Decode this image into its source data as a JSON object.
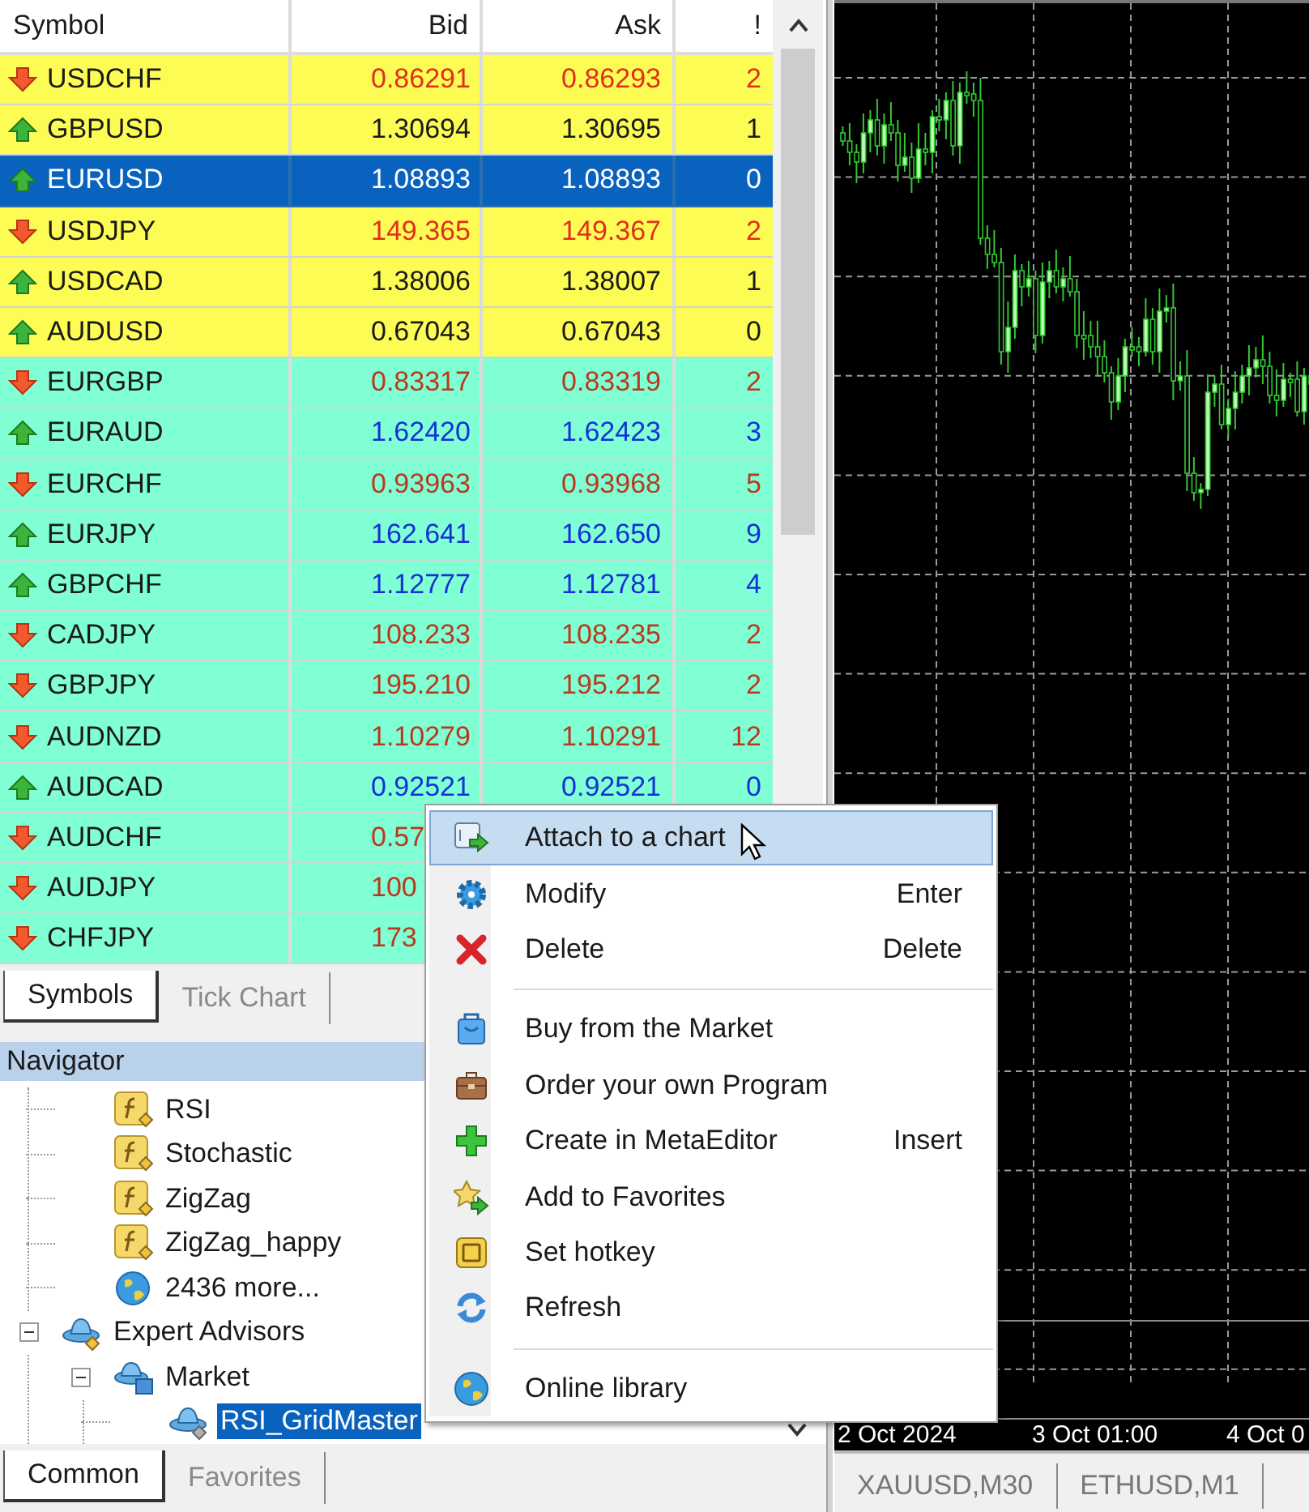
{
  "market_watch": {
    "columns": [
      "Symbol",
      "Bid",
      "Ask",
      "!"
    ],
    "rows": [
      {
        "symbol": "USDCHF",
        "kind": "down",
        "color": "#fcfc55",
        "selected": false,
        "quote": {
          "bid": "0.86291",
          "ask": "0.86293",
          "spread": "2",
          "color": "#e0301c"
        }
      },
      {
        "symbol": "GBPUSD",
        "kind": "up",
        "color": "#fcfc55",
        "selected": false,
        "quote": {
          "bid": "1.30694",
          "ask": "1.30695",
          "spread": "1",
          "color": "#1a1a1a"
        }
      },
      {
        "symbol": "EURUSD",
        "kind": "up",
        "selected": true,
        "quote": {
          "bid": "1.08893",
          "ask": "1.08893",
          "spread": "0"
        }
      },
      {
        "symbol": "USDJPY",
        "kind": "down",
        "color": "#fcfc55",
        "selected": false,
        "quote": {
          "bid": "149.365",
          "ask": "149.367",
          "spread": "2",
          "color": "#e0301c"
        }
      },
      {
        "symbol": "USDCAD",
        "kind": "up",
        "color": "#fcfc55",
        "selected": false,
        "quote": {
          "bid": "1.38006",
          "ask": "1.38007",
          "spread": "1",
          "color": "#1a1a1a"
        }
      },
      {
        "symbol": "AUDUSD",
        "kind": "up",
        "color": "#fcfc55",
        "selected": false,
        "quote": {
          "bid": "0.67043",
          "ask": "0.67043",
          "spread": "0",
          "color": "#1a1a1a"
        }
      },
      {
        "symbol": "EURGBP",
        "kind": "down",
        "color": "#80ffd4",
        "selected": false,
        "quote": {
          "bid": "0.83317",
          "ask": "0.83319",
          "spread": "2",
          "color": "#b8391e"
        }
      },
      {
        "symbol": "EURAUD",
        "kind": "up",
        "color": "#80ffd4",
        "selected": false,
        "quote": {
          "bid": "1.62420",
          "ask": "1.62423",
          "spread": "3",
          "color": "#1430d8"
        }
      },
      {
        "symbol": "EURCHF",
        "kind": "down",
        "color": "#80ffd4",
        "selected": false,
        "quote": {
          "bid": "0.93963",
          "ask": "0.93968",
          "spread": "5",
          "color": "#b8391e"
        }
      },
      {
        "symbol": "EURJPY",
        "kind": "up",
        "color": "#80ffd4",
        "selected": false,
        "quote": {
          "bid": "162.641",
          "ask": "162.650",
          "spread": "9",
          "color": "#1430d8"
        }
      },
      {
        "symbol": "GBPCHF",
        "kind": "up",
        "color": "#80ffd4",
        "selected": false,
        "quote": {
          "bid": "1.12777",
          "ask": "1.12781",
          "spread": "4",
          "color": "#1430d8"
        }
      },
      {
        "symbol": "CADJPY",
        "kind": "down",
        "color": "#80ffd4",
        "selected": false,
        "quote": {
          "bid": "108.233",
          "ask": "108.235",
          "spread": "2",
          "color": "#b8391e"
        }
      },
      {
        "symbol": "GBPJPY",
        "kind": "down",
        "color": "#80ffd4",
        "selected": false,
        "quote": {
          "bid": "195.210",
          "ask": "195.212",
          "spread": "2",
          "color": "#b8391e"
        }
      },
      {
        "symbol": "AUDNZD",
        "kind": "down",
        "color": "#80ffd4",
        "selected": false,
        "quote": {
          "bid": "1.10279",
          "ask": "1.10291",
          "spread": "12",
          "color": "#b8391e"
        }
      },
      {
        "symbol": "AUDCAD",
        "kind": "up",
        "color": "#80ffd4",
        "selected": false,
        "quote": {
          "bid": "0.92521",
          "ask": "0.92521",
          "spread": "0",
          "color": "#1430d8"
        }
      },
      {
        "symbol": "AUDCHF",
        "kind": "down",
        "color": "#80ffd4",
        "selected": false,
        "quote": {
          "bid": "0.57",
          "color": "#b8391e"
        }
      },
      {
        "symbol": "AUDJPY",
        "kind": "down",
        "color": "#80ffd4",
        "selected": false,
        "quote": {
          "bid": "100",
          "color": "#b8391e"
        }
      },
      {
        "symbol": "CHFJPY",
        "kind": "down",
        "color": "#80ffd4",
        "selected": false,
        "quote": {
          "bid": "173",
          "color": "#b8391e"
        }
      }
    ],
    "tabs": [
      {
        "label": "Symbols",
        "selected": true
      },
      {
        "label": "Tick Chart",
        "selected": false
      }
    ]
  },
  "navigator": {
    "title": "Navigator",
    "tree": [
      {
        "kind": "offscreen",
        "children": [
          {
            "label": "RSI",
            "kind": "indicator",
            "selected": false
          },
          {
            "label": "Stochastic",
            "kind": "indicator",
            "selected": false
          },
          {
            "label": "ZigZag",
            "kind": "indicator",
            "selected": false
          },
          {
            "label": "ZigZag_happy",
            "kind": "indicator",
            "selected": false
          },
          {
            "label": "2436 more...",
            "kind": "link",
            "selected": false
          }
        ]
      },
      {
        "label": "Expert Advisors",
        "kind": "folder",
        "expanded": true,
        "selected": false,
        "children": [
          {
            "label": "Market",
            "kind": "market",
            "expanded": true,
            "selected": false,
            "children": [
              {
                "label": "RSI_GridMaster",
                "kind": "expert",
                "selected": true
              }
            ]
          }
        ]
      }
    ],
    "tabs": [
      {
        "label": "Common",
        "selected": true
      },
      {
        "label": "Favorites",
        "selected": false
      }
    ]
  },
  "chart": {
    "time_labels": [
      "2 Oct 2024",
      "3 Oct 01:00",
      "4 Oct 0"
    ],
    "tabs": [
      {
        "label": "XAUUSD,M30",
        "selected": false
      },
      {
        "label": "ETHUSD,M1",
        "selected": false
      }
    ]
  },
  "context_menu": {
    "items": [
      {
        "kind": "command",
        "label": "Attach to a chart",
        "highlighted": true
      },
      {
        "kind": "command",
        "label": "Modify",
        "shortcut": "Enter",
        "highlighted": false
      },
      {
        "kind": "command",
        "label": "Delete",
        "shortcut": "Delete",
        "highlighted": false
      },
      {
        "kind": "separator"
      },
      {
        "kind": "command",
        "label": "Buy from the Market",
        "highlighted": false
      },
      {
        "kind": "command",
        "label": "Order your own Program",
        "highlighted": false
      },
      {
        "kind": "command",
        "label": "Create in MetaEditor",
        "shortcut": "Insert",
        "highlighted": false
      },
      {
        "kind": "command",
        "label": "Add to Favorites",
        "highlighted": false
      },
      {
        "kind": "command",
        "label": "Set hotkey",
        "highlighted": false
      },
      {
        "kind": "command",
        "label": "Refresh",
        "highlighted": false
      },
      {
        "kind": "separator"
      },
      {
        "kind": "command",
        "label": "Online library",
        "highlighted": false
      }
    ]
  }
}
